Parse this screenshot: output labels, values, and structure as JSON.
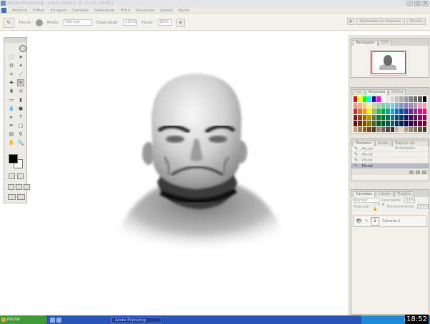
{
  "window": {
    "title": "Adobe Photoshop - [Sem título-1 @ 22,3% (RGB)]"
  },
  "menu": [
    "Arquivo",
    "Editar",
    "Imagem",
    "Camada",
    "Selecionar",
    "Filtro",
    "Visualizar",
    "Janela",
    "Ajuda"
  ],
  "options": {
    "brush_label": "Pincel:",
    "mode_label": "Modo:",
    "mode_value": "Normal",
    "opacity_label": "Opacidade:",
    "opacity_value": "100%",
    "flow_label": "Fluxo:",
    "flow_value": "60%"
  },
  "palette_well": [
    "Explorador de Arquivos",
    "Pincéis"
  ],
  "navigator": {
    "tabs": [
      "Navegador",
      "Info"
    ]
  },
  "swatches": {
    "tabs": [
      "Cor",
      "Amostras",
      "Estilos"
    ],
    "colors": [
      "#ff0000",
      "#ffff00",
      "#00ff00",
      "#00ffff",
      "#0000ff",
      "#ff00ff",
      "#ffffff",
      "#ebebeb",
      "#d6d6d6",
      "#c2c2c2",
      "#adadad",
      "#999999",
      "#858585",
      "#707070",
      "#5c5c5c",
      "#000000",
      "#f7977a",
      "#f9ad81",
      "#fdc68a",
      "#fff79a",
      "#c4df9b",
      "#a2d39c",
      "#82ca9d",
      "#7bcdc8",
      "#6ecff6",
      "#7ea7d8",
      "#8493ca",
      "#8882be",
      "#a187be",
      "#bc8dbf",
      "#f49ac2",
      "#f6989d",
      "#ed1c24",
      "#f26522",
      "#f7941d",
      "#fff200",
      "#8dc63f",
      "#39b54a",
      "#00a651",
      "#00a99d",
      "#00aeef",
      "#0072bc",
      "#0054a6",
      "#2e3192",
      "#662d91",
      "#92278f",
      "#ec008c",
      "#ed145b",
      "#9e0b0f",
      "#a0410d",
      "#a36209",
      "#aba000",
      "#598527",
      "#1a7b30",
      "#007236",
      "#00746b",
      "#0076a3",
      "#004b80",
      "#003471",
      "#1b1464",
      "#440e62",
      "#630460",
      "#9e005d",
      "#9e0039",
      "#790000",
      "#7b2e00",
      "#7d4900",
      "#827b00",
      "#406618",
      "#005e20",
      "#005826",
      "#005952",
      "#005b7f",
      "#003663",
      "#002157",
      "#0d004c",
      "#32004b",
      "#4b0049",
      "#7b0046",
      "#7a0026",
      "#c69c6d",
      "#a67c52",
      "#8c6239",
      "#754c24",
      "#603913",
      "#998675",
      "#736357",
      "#534741",
      "#362f2d",
      "#c7b299",
      "#e8d7c1",
      "#b0a08a",
      "#958873",
      "#7d705f",
      "#5f5444",
      "#42392f"
    ]
  },
  "history": {
    "tabs": [
      "Histórico",
      "Ações",
      "Trajetos de ferramenta"
    ],
    "items": [
      "Pincel",
      "Pincel",
      "Pincel",
      "Pincel"
    ],
    "selected_index": 3
  },
  "layers": {
    "tabs": [
      "Camadas",
      "Canais",
      "Trajetos"
    ],
    "mode_value": "Normal",
    "opacity_label": "Opacidade:",
    "opacity_value": "100%",
    "lock_label": "Bloquear:",
    "fill_label": "Preenchimento:",
    "fill_value": "100%",
    "layer_name": "Camada 1",
    "layer_thumb_text": "2"
  },
  "taskbar": {
    "start_label": "Iniciar",
    "task_label": "Adobe Photoshop"
  },
  "clock": "18:52"
}
